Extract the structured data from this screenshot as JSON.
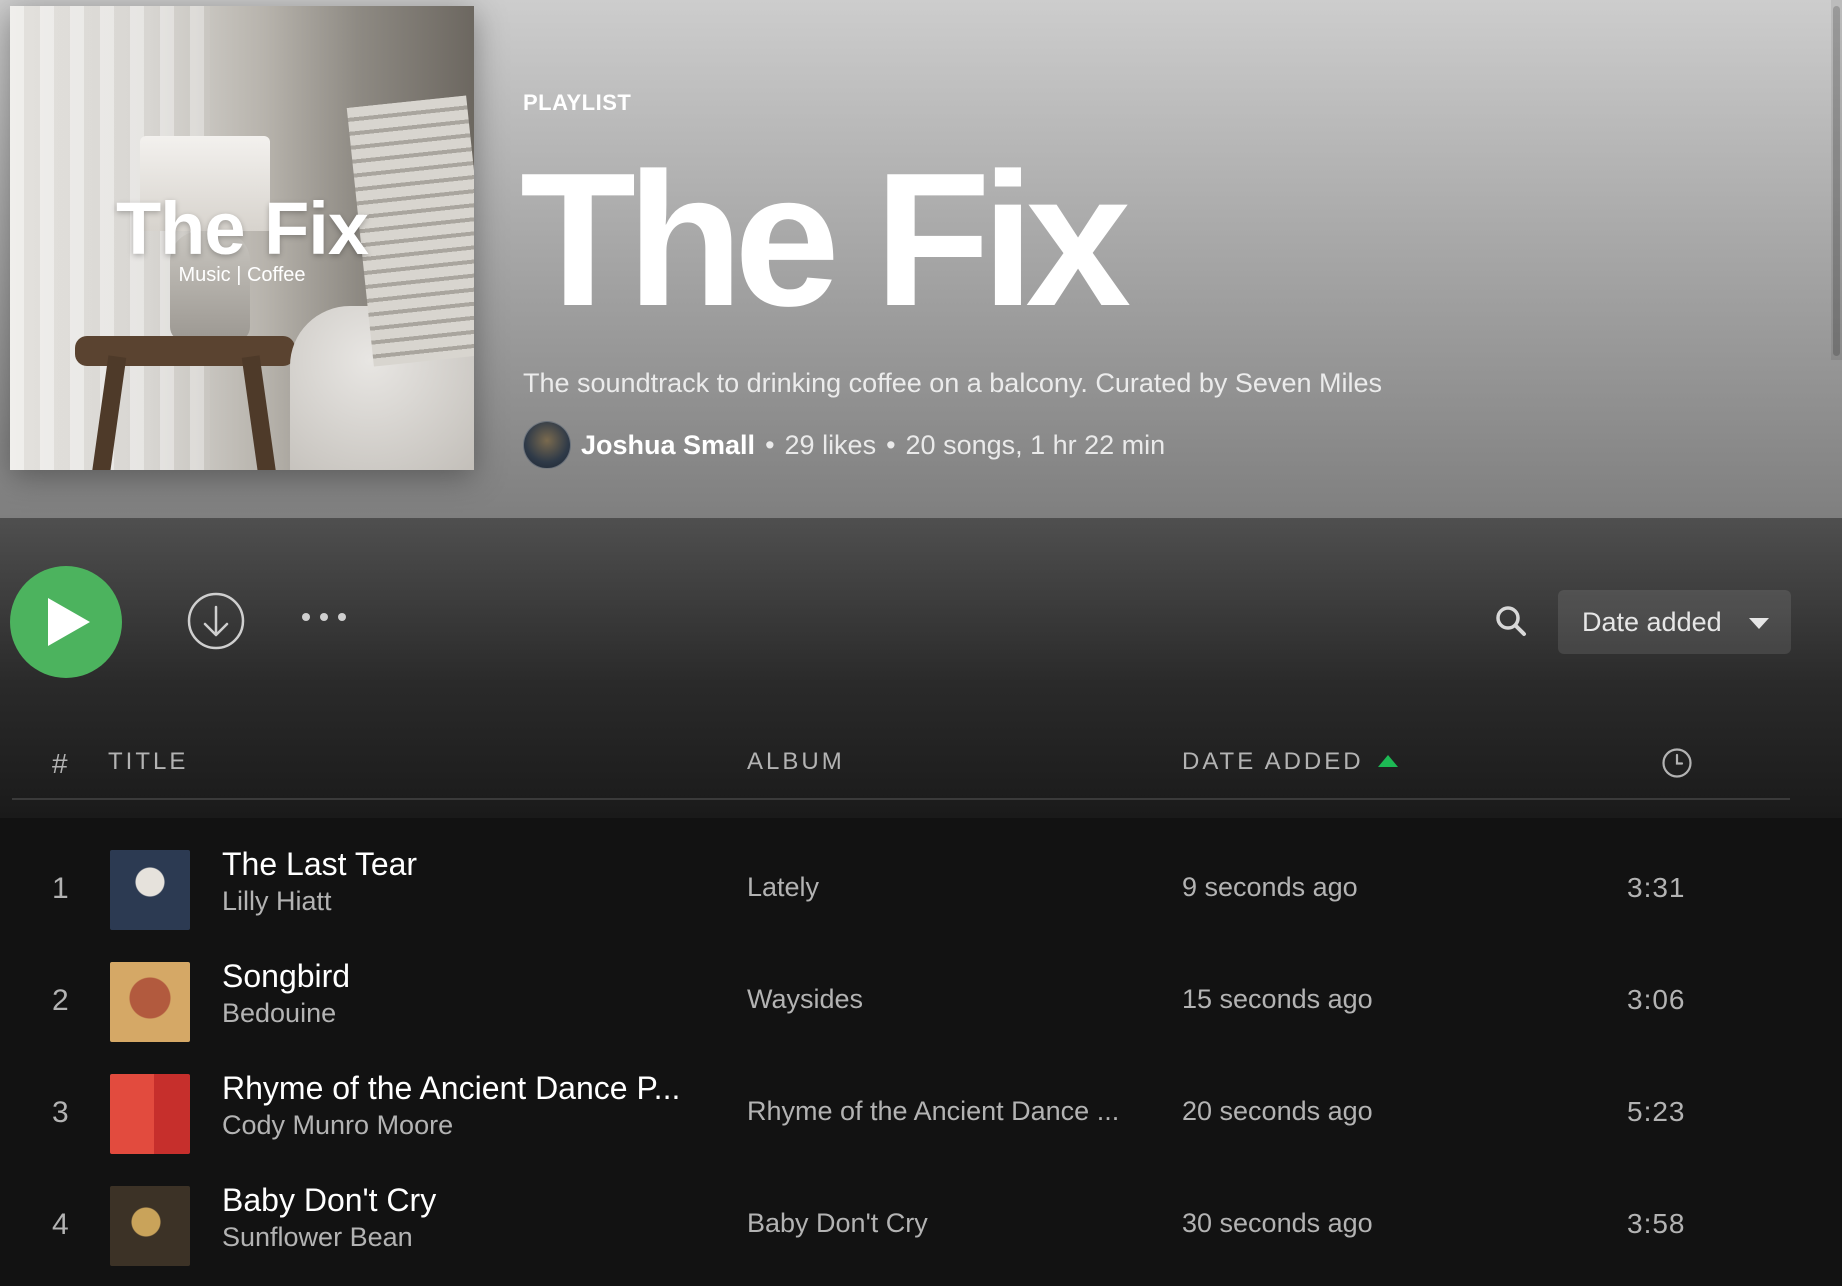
{
  "playlist": {
    "type_label": "PLAYLIST",
    "title": "The Fix",
    "description": "The soundtrack to drinking coffee on a balcony. Curated by Seven Miles",
    "owner": "Joshua Small",
    "likes": "29 likes",
    "songs_duration": "20 songs, 1 hr 22 min",
    "separator": "•",
    "cover": {
      "title": "The Fix",
      "subtitle": "Music | Coffee"
    }
  },
  "controls": {
    "play_icon": "play-icon",
    "download_icon": "download-icon",
    "more_icon": "more-options-icon",
    "search_icon": "search-icon",
    "sort_label": "Date added",
    "accent_color": "#1db954"
  },
  "table": {
    "headers": {
      "number": "#",
      "title": "TITLE",
      "album": "ALBUM",
      "date_added": "DATE ADDED",
      "duration_icon": "clock-icon"
    },
    "tracks": [
      {
        "number": "1",
        "title": "The Last Tear",
        "artist": "Lilly Hiatt",
        "album": "Lately",
        "date_added": "9 seconds ago",
        "duration": "3:31"
      },
      {
        "number": "2",
        "title": "Songbird",
        "artist": "Bedouine",
        "album": "Waysides",
        "date_added": "15 seconds ago",
        "duration": "3:06"
      },
      {
        "number": "3",
        "title": "Rhyme of the Ancient Dance P...",
        "artist": "Cody Munro Moore",
        "album": "Rhyme of the Ancient Dance ...",
        "date_added": "20 seconds ago",
        "duration": "5:23"
      },
      {
        "number": "4",
        "title": "Baby Don't Cry",
        "artist": "Sunflower Bean",
        "album": "Baby Don't Cry",
        "date_added": "30 seconds ago",
        "duration": "3:58"
      }
    ]
  }
}
